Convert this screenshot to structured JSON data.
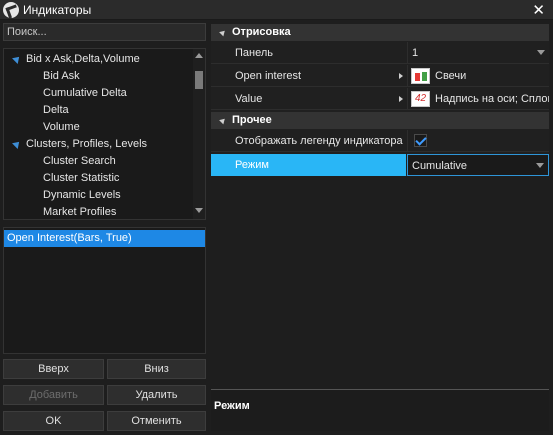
{
  "window": {
    "title": "Индикаторы",
    "close_icon": "close-icon"
  },
  "search": {
    "placeholder": "Поиск..."
  },
  "tree": {
    "groups": [
      {
        "label": "Bid x Ask,Delta,Volume",
        "items": [
          "Bid Ask",
          "Cumulative Delta",
          "Delta",
          "Volume"
        ]
      },
      {
        "label": "Clusters, Profiles, Levels",
        "items": [
          "Cluster Search",
          "Cluster Statistic",
          "Dynamic Levels",
          "Market Profiles"
        ]
      }
    ]
  },
  "applied": {
    "items": [
      "Open Interest(Bars, True)"
    ]
  },
  "buttons": {
    "up": "Вверх",
    "down": "Вниз",
    "add": "Добавить",
    "delete": "Удалить",
    "ok": "OK",
    "cancel": "Отменить"
  },
  "properties": {
    "section_render": "Отрисовка",
    "panel_label": "Панель",
    "panel_value": "1",
    "open_interest_label": "Open interest",
    "open_interest_value": "Свечи",
    "value_label": "Value",
    "value_icon_text": "42",
    "value_value": "Надпись на оси;  Сплош",
    "section_other": "Прочее",
    "legend_label": "Отображать легенду индикатора",
    "legend_checked": true,
    "mode_label": "Режим",
    "mode_value": "Cumulative"
  },
  "description": {
    "title": "Режим"
  },
  "colors": {
    "selected_row": "#1e88e5",
    "selected_property": "#29b6f6",
    "tree_arrow": "#3e8ed6"
  }
}
